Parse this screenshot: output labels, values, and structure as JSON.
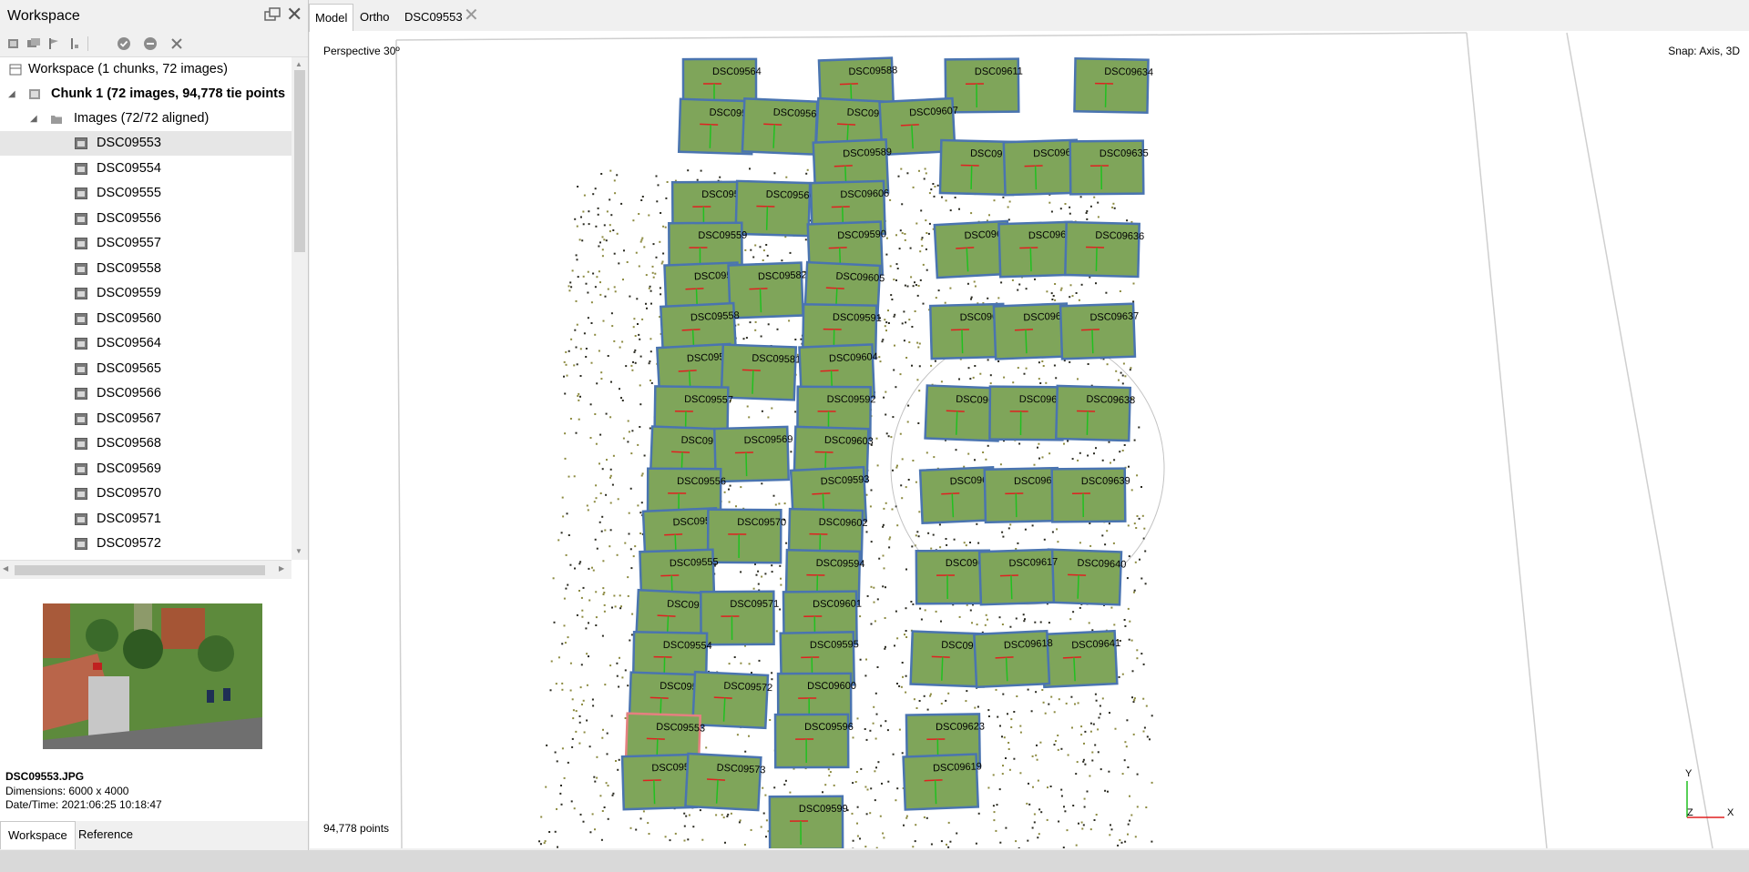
{
  "workspace": {
    "title": "Workspace",
    "root_label": "Workspace (1 chunks, 72 images)",
    "chunk_label": "Chunk 1 (72 images, 94,778 tie points",
    "images_folder_label": "Images (72/72 aligned)",
    "items": [
      "DSC09553",
      "DSC09554",
      "DSC09555",
      "DSC09556",
      "DSC09557",
      "DSC09558",
      "DSC09559",
      "DSC09560",
      "DSC09564",
      "DSC09565",
      "DSC09566",
      "DSC09567",
      "DSC09568",
      "DSC09569",
      "DSC09570",
      "DSC09571",
      "DSC09572"
    ],
    "selected_item": "DSC09553"
  },
  "selected_image": {
    "filename": "DSC09553.JPG",
    "dimensions": "Dimensions: 6000 x 4000",
    "datetime": "Date/Time: 2021:06:25 10:18:47"
  },
  "bottom_tabs": {
    "workspace": "Workspace",
    "reference": "Reference"
  },
  "view_tabs": {
    "model": "Model",
    "ortho": "Ortho",
    "photo": "DSC09553"
  },
  "viewport": {
    "projection": "Perspective 30º",
    "snap": "Snap: Axis, 3D",
    "point_count": "94,778 points",
    "axis_y": "Y",
    "axis_z": "Z",
    "axis_x": "X"
  },
  "cameras": [
    {
      "label": "DSC09564",
      "col": "A",
      "row": 0
    },
    {
      "label": "DSC09588",
      "col": "B",
      "row": 0
    },
    {
      "label": "DSC09611",
      "col": "C",
      "row": 0
    },
    {
      "label": "DSC09634",
      "col": "D",
      "row": 0
    },
    {
      "label": "DSC09560",
      "col": "A",
      "row": 1
    },
    {
      "label": "DSC09565",
      "col": "A",
      "row": 1
    },
    {
      "label": "DSC09584",
      "col": "B",
      "row": 1
    },
    {
      "label": "DSC09607",
      "col": "B",
      "row": 1
    },
    {
      "label": "DSC09589",
      "col": "B",
      "row": 2
    },
    {
      "label": "DSC09612",
      "col": "C",
      "row": 2
    },
    {
      "label": "DSC09630",
      "col": "C",
      "row": 2
    },
    {
      "label": "DSC09635",
      "col": "D",
      "row": 2
    },
    {
      "label": "DSC09583",
      "col": "A",
      "row": 3
    },
    {
      "label": "DSC09566",
      "col": "A",
      "row": 3
    },
    {
      "label": "DSC09606",
      "col": "B",
      "row": 3
    },
    {
      "label": "DSC09559",
      "col": "A",
      "row": 4
    },
    {
      "label": "DSC09590",
      "col": "B",
      "row": 4
    },
    {
      "label": "DSC09613",
      "col": "C",
      "row": 4
    },
    {
      "label": "DSC09629",
      "col": "C",
      "row": 4
    },
    {
      "label": "DSC09636",
      "col": "D",
      "row": 4
    },
    {
      "label": "DSC09567",
      "col": "A",
      "row": 5
    },
    {
      "label": "DSC09582",
      "col": "A",
      "row": 5
    },
    {
      "label": "DSC09605",
      "col": "B",
      "row": 5
    },
    {
      "label": "DSC09558",
      "col": "A",
      "row": 6
    },
    {
      "label": "DSC09591",
      "col": "B",
      "row": 6
    },
    {
      "label": "DSC09614",
      "col": "C",
      "row": 6
    },
    {
      "label": "DSC09628",
      "col": "C",
      "row": 6
    },
    {
      "label": "DSC09637",
      "col": "D",
      "row": 6
    },
    {
      "label": "DSC09568",
      "col": "A",
      "row": 7
    },
    {
      "label": "DSC09581",
      "col": "A",
      "row": 7
    },
    {
      "label": "DSC09604",
      "col": "B",
      "row": 7
    },
    {
      "label": "DSC09557",
      "col": "A",
      "row": 8
    },
    {
      "label": "DSC09592",
      "col": "B",
      "row": 8
    },
    {
      "label": "DSC09627",
      "col": "C",
      "row": 8
    },
    {
      "label": "DSC09615",
      "col": "C",
      "row": 8
    },
    {
      "label": "DSC09638",
      "col": "D",
      "row": 8
    },
    {
      "label": "DSC09580",
      "col": "A",
      "row": 9
    },
    {
      "label": "DSC09569",
      "col": "A",
      "row": 9
    },
    {
      "label": "DSC09603",
      "col": "B",
      "row": 9
    },
    {
      "label": "DSC09556",
      "col": "A",
      "row": 10
    },
    {
      "label": "DSC09593",
      "col": "B",
      "row": 10
    },
    {
      "label": "DSC09626",
      "col": "C",
      "row": 10
    },
    {
      "label": "DSC09616",
      "col": "C",
      "row": 10
    },
    {
      "label": "DSC09639",
      "col": "D",
      "row": 10
    },
    {
      "label": "DSC09579",
      "col": "A",
      "row": 11
    },
    {
      "label": "DSC09570",
      "col": "A",
      "row": 11
    },
    {
      "label": "DSC09602",
      "col": "B",
      "row": 11
    },
    {
      "label": "DSC09555",
      "col": "A",
      "row": 12
    },
    {
      "label": "DSC09594",
      "col": "B",
      "row": 12
    },
    {
      "label": "DSC09625",
      "col": "C",
      "row": 12
    },
    {
      "label": "DSC09640",
      "col": "D",
      "row": 12
    },
    {
      "label": "DSC09617",
      "col": "C",
      "row": 12
    },
    {
      "label": "DSC09578",
      "col": "A",
      "row": 13
    },
    {
      "label": "DSC09601",
      "col": "B",
      "row": 13
    },
    {
      "label": "DSC09571",
      "col": "A",
      "row": 13
    },
    {
      "label": "DSC09554",
      "col": "A",
      "row": 14
    },
    {
      "label": "DSC09595",
      "col": "B",
      "row": 14
    },
    {
      "label": "DSC09624",
      "col": "C",
      "row": 14
    },
    {
      "label": "DSC09641",
      "col": "D",
      "row": 14
    },
    {
      "label": "DSC09618",
      "col": "C",
      "row": 14
    },
    {
      "label": "DSC09577",
      "col": "A",
      "row": 15
    },
    {
      "label": "DSC09600",
      "col": "B",
      "row": 15
    },
    {
      "label": "DSC09572",
      "col": "A",
      "row": 15
    },
    {
      "label": "DSC09553",
      "col": "A",
      "row": 16,
      "selected": true
    },
    {
      "label": "DSC09623",
      "col": "C",
      "row": 16
    },
    {
      "label": "DSC09596",
      "col": "B",
      "row": 16
    },
    {
      "label": "DSC09576",
      "col": "A",
      "row": 17
    },
    {
      "label": "DSC09619",
      "col": "C",
      "row": 17
    },
    {
      "label": "DSC09573",
      "col": "A",
      "row": 17
    },
    {
      "label": "DSC09599",
      "col": "B",
      "row": 18
    }
  ],
  "colors": {
    "camera_border": "#4a74b0",
    "selected_border": "#e58080",
    "field": "#7fa55a",
    "axis_x": "#e02020",
    "axis_y": "#20c020",
    "axis_z": "#2030d0"
  }
}
